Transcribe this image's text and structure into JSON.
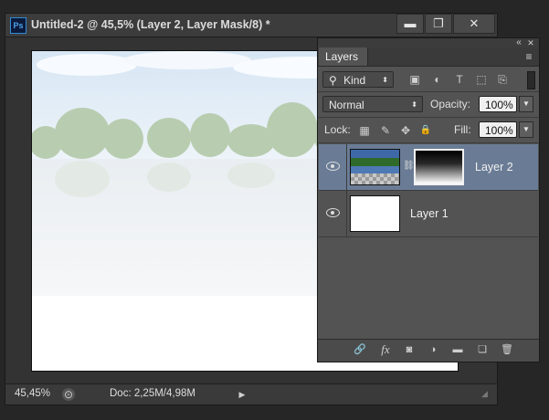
{
  "document": {
    "title": "Untitled-2 @ 45,5% (Layer 2, Layer Mask/8) *",
    "app_icon_label": "Ps",
    "window_controls": {
      "minimize": "▬",
      "maximize": "❐",
      "close": "✕"
    },
    "status": {
      "zoom": "45,45%",
      "doc_info": "Doc: 2,25M/4,98M",
      "next_arrow": "▶"
    }
  },
  "layers_panel": {
    "collapse_icon": "«",
    "menu_icon": "≡",
    "tab_label": "Layers",
    "filter": {
      "search_icon": "⚲",
      "value": "Kind"
    },
    "filter_icons": [
      "image-filter-icon",
      "adjustment-filter-icon",
      "type-filter-icon",
      "shape-filter-icon",
      "smart-object-filter-icon"
    ],
    "filter_icon_glyphs": [
      "▣",
      "◐",
      "T",
      "⬚",
      "⎘"
    ],
    "blend_mode": "Normal",
    "opacity": {
      "label": "Opacity:",
      "value": "100%"
    },
    "lock": {
      "label": "Lock:",
      "icons": [
        "▦",
        "✎",
        "✥",
        "🔒"
      ]
    },
    "fill": {
      "label": "Fill:",
      "value": "100%"
    },
    "layers": [
      {
        "name": "Layer 2",
        "selected": true,
        "has_mask": true,
        "link_glyph": "⛓"
      },
      {
        "name": "Layer 1",
        "selected": false,
        "has_mask": false
      }
    ],
    "footer_icons": [
      "🔗",
      "fx",
      "◙",
      "◑",
      "▬",
      "❏",
      "🗑"
    ]
  },
  "colors": {
    "selection": "#6a7c95",
    "panel_bg": "#535353",
    "app_bg": "#262626"
  }
}
